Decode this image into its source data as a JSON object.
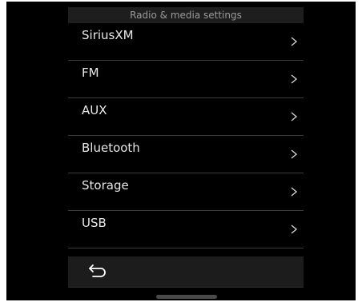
{
  "header": {
    "title": "Radio & media settings"
  },
  "menu": {
    "items": [
      {
        "label": "SiriusXM",
        "icon": "chevron-right-icon"
      },
      {
        "label": "FM",
        "icon": "chevron-right-icon"
      },
      {
        "label": "AUX",
        "icon": "chevron-right-icon"
      },
      {
        "label": "Bluetooth",
        "icon": "chevron-right-icon"
      },
      {
        "label": "Storage",
        "icon": "chevron-right-icon"
      },
      {
        "label": "USB",
        "icon": "chevron-right-icon"
      }
    ]
  },
  "footer": {
    "back_icon": "back-arrow-icon"
  },
  "colors": {
    "background": "#000000",
    "title_bar": "#1e1e1e",
    "text": "#e8e8e8",
    "divider": "#3a3a3a",
    "chevron": "#cfcfcf"
  }
}
